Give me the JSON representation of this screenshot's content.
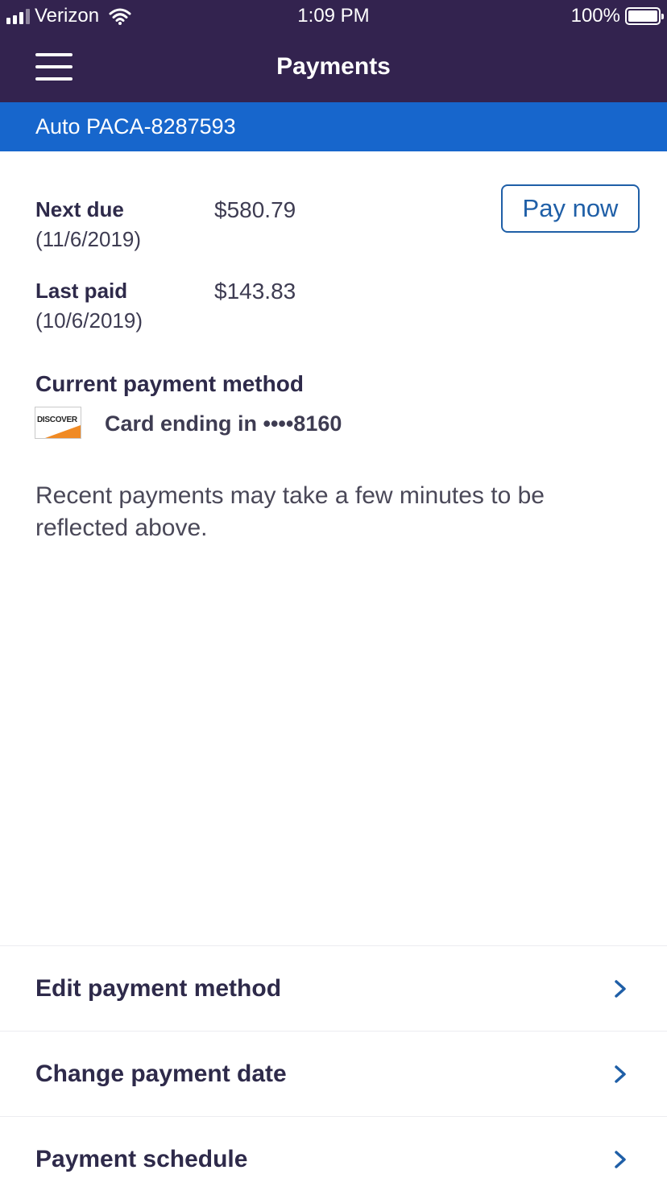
{
  "status_bar": {
    "carrier": "Verizon",
    "time": "1:09 PM",
    "battery": "100%"
  },
  "header": {
    "title": "Payments",
    "menu_icon": "hamburger-menu-icon"
  },
  "account": {
    "name": "Auto PACA-8287593"
  },
  "next_due": {
    "label": "Next due",
    "date": "(11/6/2019)",
    "amount": "$580.79"
  },
  "last_paid": {
    "label": "Last paid",
    "date": "(10/6/2019)",
    "amount": "$143.83"
  },
  "pay_now": {
    "label": "Pay now"
  },
  "payment_method": {
    "title": "Current payment method",
    "card_brand": "DISCOVER",
    "card_text": "Card ending in ••••8160"
  },
  "note": "Recent payments may take a few minutes to be reflected above.",
  "actions": [
    {
      "label": "Edit payment method"
    },
    {
      "label": "Change payment date"
    },
    {
      "label": "Payment schedule"
    }
  ],
  "colors": {
    "header_bg": "#33234f",
    "account_bar_bg": "#1766cc",
    "button_accent": "#1f5fa7",
    "chevron": "#1f5fa7"
  }
}
